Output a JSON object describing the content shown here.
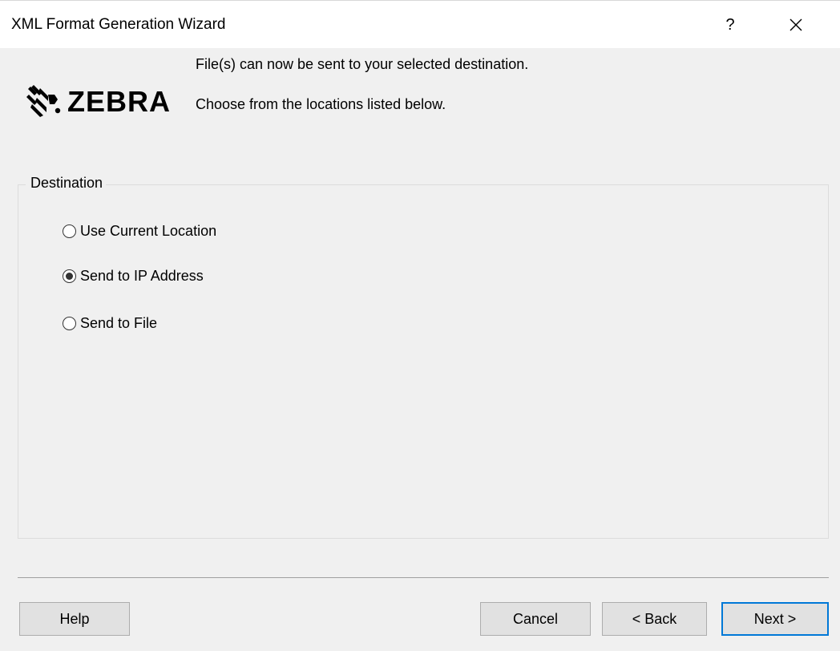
{
  "window": {
    "title": "XML Format Generation Wizard",
    "help_glyph": "?",
    "close_icon": "close-icon"
  },
  "brand": {
    "logo_text": "ZEBRA",
    "logo_icon": "zebra-head-icon"
  },
  "intro": {
    "line1": "File(s) can now be sent to your selected destination.",
    "line2": "Choose from the locations listed below."
  },
  "destination": {
    "legend": "Destination",
    "options": [
      {
        "label": "Use Current Location",
        "selected": false
      },
      {
        "label": "Send to IP Address",
        "selected": true
      },
      {
        "label": "Send to File",
        "selected": false
      }
    ]
  },
  "buttons": {
    "help": "Help",
    "cancel": "Cancel",
    "back": "< Back",
    "next": "Next >"
  },
  "colors": {
    "dialog_bg": "#f0f0f0",
    "titlebar_bg": "#ffffff",
    "default_button_border": "#0078d7"
  }
}
